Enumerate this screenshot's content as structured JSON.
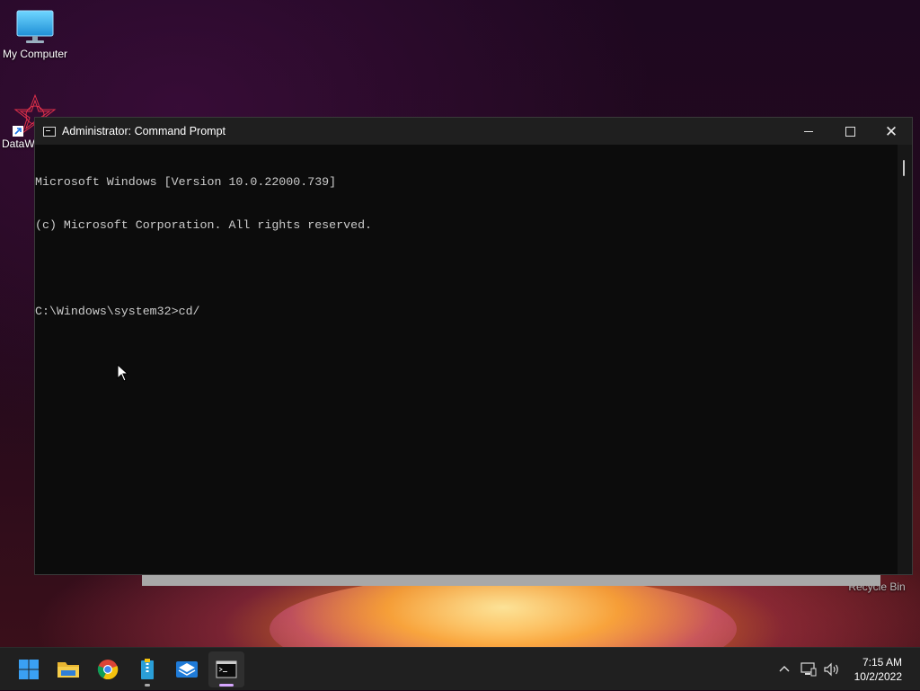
{
  "desktop": {
    "icons": [
      {
        "label": "My Computer"
      },
      {
        "label": "DataW"
      }
    ],
    "recycle_bin_label": "Recycle Bin"
  },
  "window": {
    "title": "Administrator: Command Prompt",
    "console_lines": [
      "Microsoft Windows [Version 10.0.22000.739]",
      "(c) Microsoft Corporation. All rights reserved.",
      "",
      "C:\\Windows\\system32>cd/"
    ],
    "colors": {
      "console_bg": "#0c0c0c",
      "console_text": "#cccccc",
      "titlebar_bg": "#1f1f1f"
    }
  },
  "taskbar": {
    "apps": [
      {
        "name": "start-button",
        "icon": "windows-logo-icon"
      },
      {
        "name": "file-explorer",
        "icon": "folder-icon"
      },
      {
        "name": "chrome",
        "icon": "chrome-icon"
      },
      {
        "name": "archive-app",
        "icon": "archive-icon"
      },
      {
        "name": "mail-app",
        "icon": "envelope-icon"
      },
      {
        "name": "command-prompt",
        "icon": "terminal-icon",
        "active": true
      }
    ],
    "tray_icons": [
      "chevron-up-icon",
      "network-icon",
      "speaker-icon"
    ],
    "time": "7:15 AM",
    "date": "10/2/2022"
  }
}
